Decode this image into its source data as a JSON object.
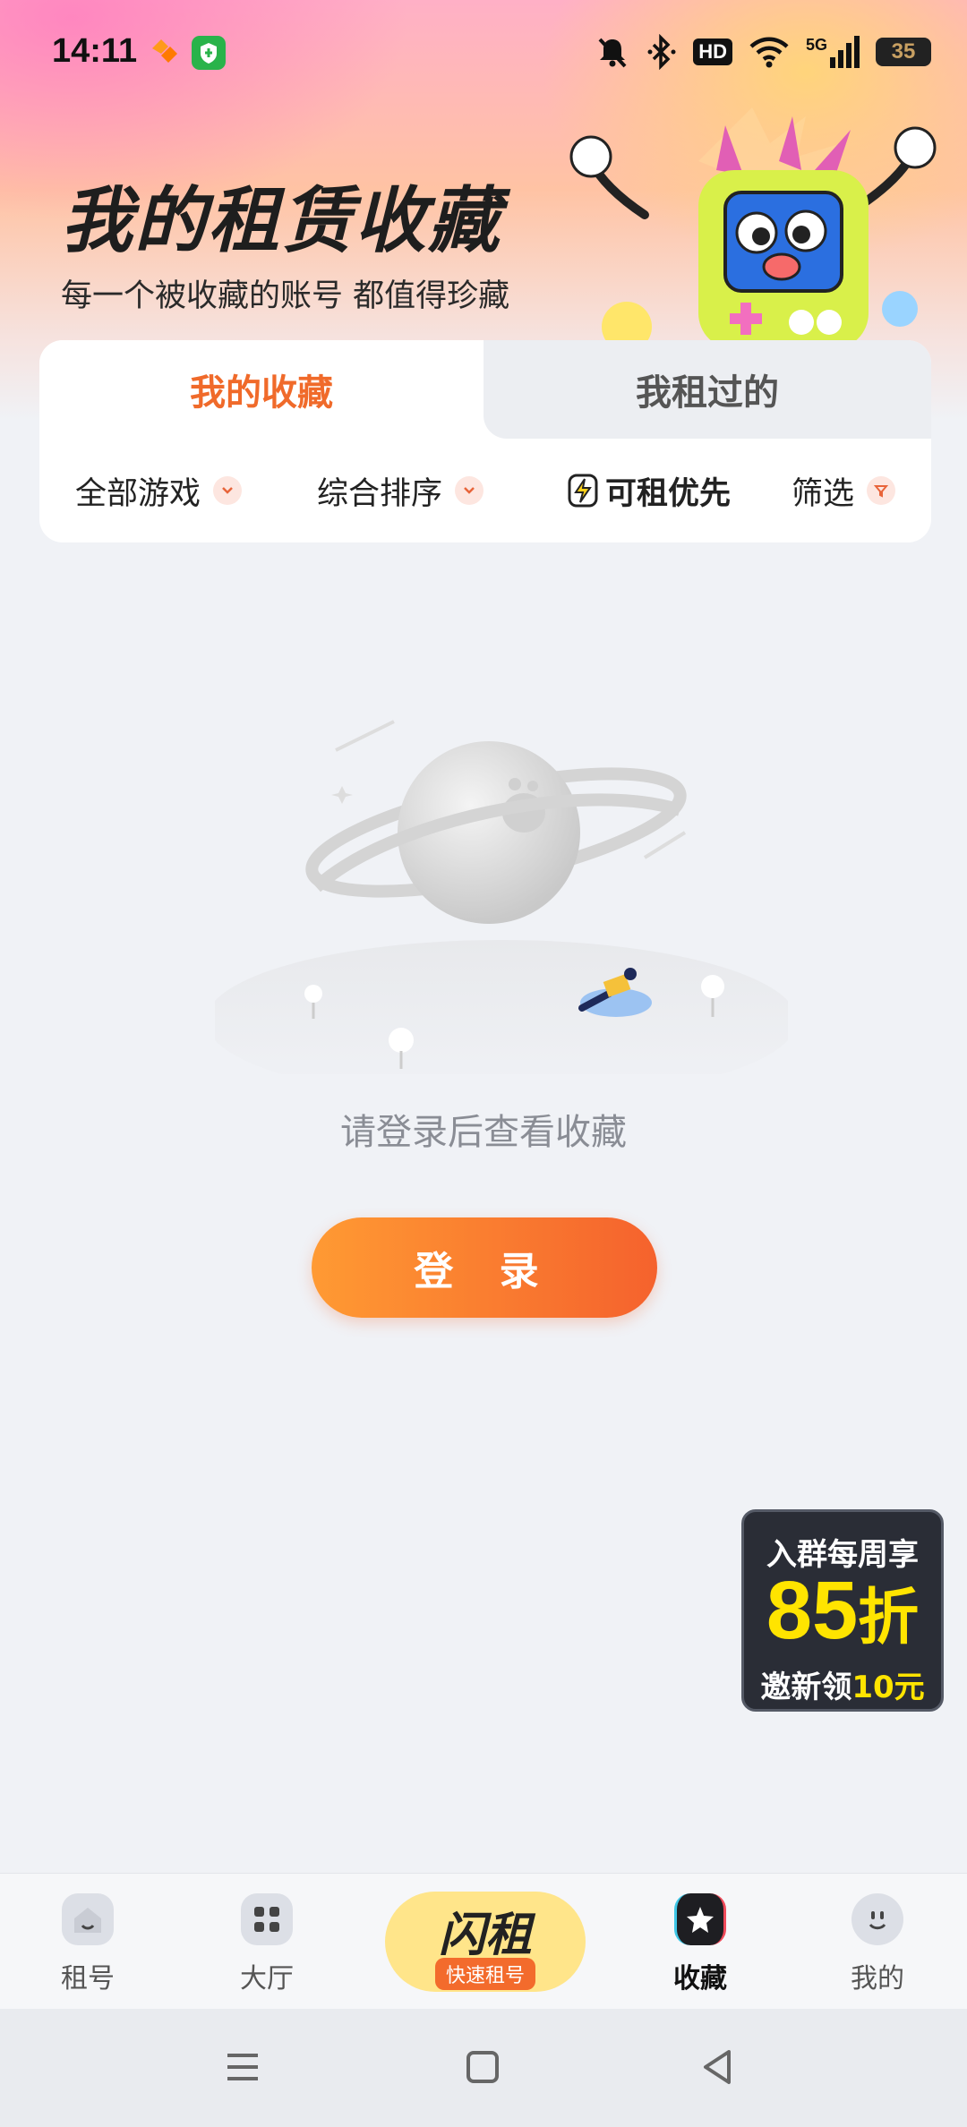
{
  "status_bar": {
    "time": "14:11",
    "hd_badge": "HD",
    "network": "5G",
    "battery": "35"
  },
  "header": {
    "title": "我的租赁收藏",
    "subtitle": "每一个被收藏的账号 都值得珍藏"
  },
  "tabs": [
    {
      "label": "我的收藏",
      "active": true
    },
    {
      "label": "我租过的",
      "active": false
    }
  ],
  "filters": {
    "games": "全部游戏",
    "sort": "综合排序",
    "priority": "可租优先",
    "filter": "筛选"
  },
  "empty_state": {
    "message": "请登录后查看收藏",
    "login_button": "登 录"
  },
  "promo": {
    "line1": "入群每周享",
    "discount": "85",
    "discount_unit": "折",
    "line3_prefix": "邀新领",
    "line3_amount": "10元"
  },
  "bottom_nav": {
    "items": [
      {
        "label": "租号",
        "icon": "home-icon"
      },
      {
        "label": "大厅",
        "icon": "grid-icon"
      },
      {
        "label": "收藏",
        "icon": "star-icon",
        "active": true
      },
      {
        "label": "我的",
        "icon": "profile-icon"
      }
    ],
    "center": {
      "title": "闪租",
      "subtitle": "快速租号"
    }
  },
  "colors": {
    "accent": "#f06a2a",
    "promo_yellow": "#ffe400"
  }
}
